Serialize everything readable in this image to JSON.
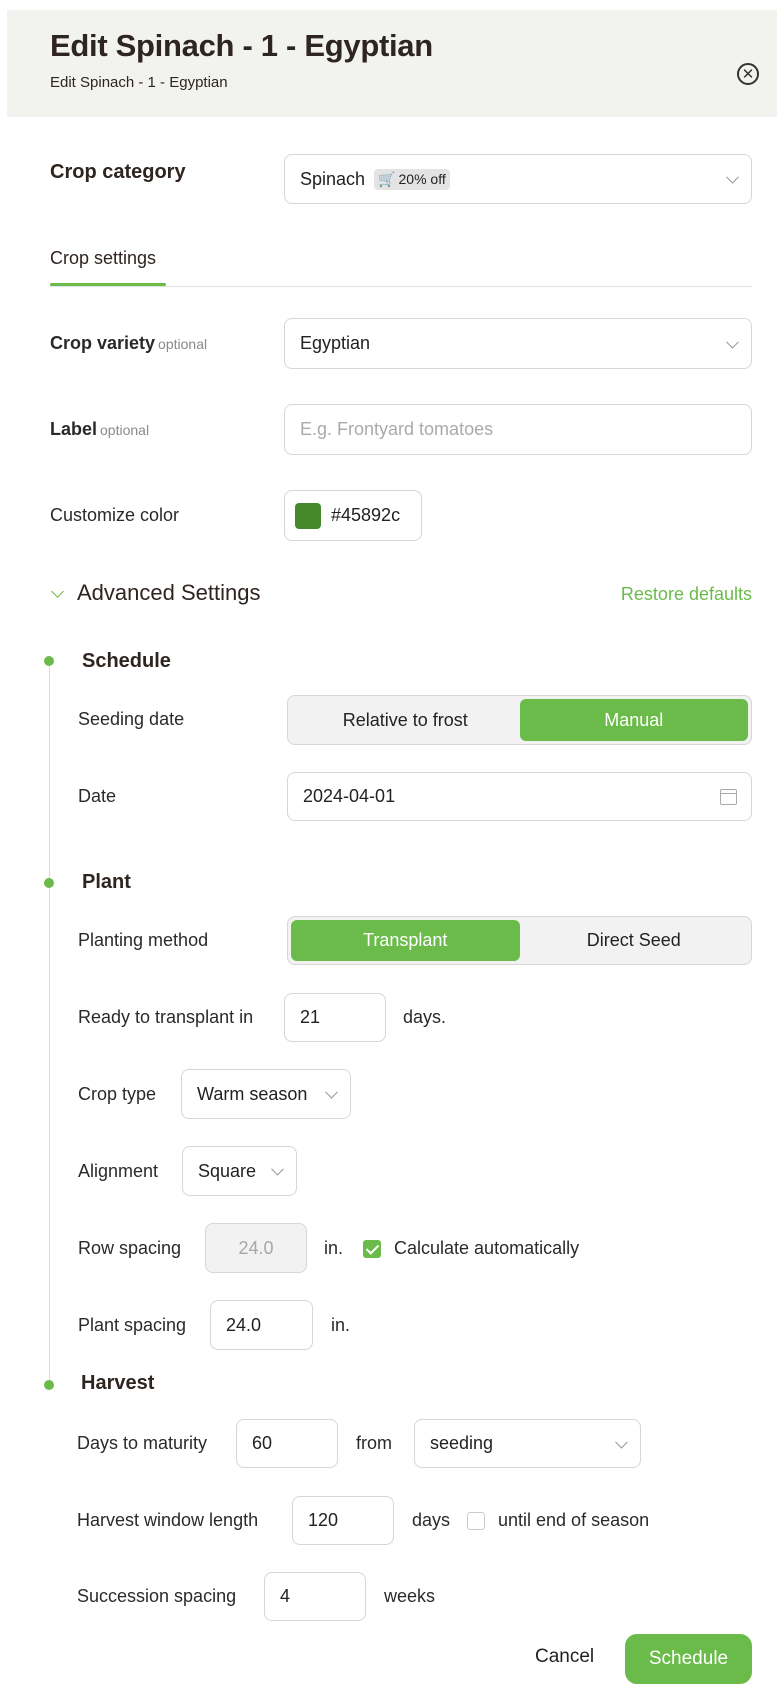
{
  "header": {
    "title": "Edit Spinach - 1 - Egyptian",
    "subtitle": "Edit Spinach - 1 - Egyptian",
    "close_icon": "close-circle-icon"
  },
  "crop_category": {
    "label": "Crop category",
    "value": "Spinach",
    "badge_icon": "cart-icon",
    "badge_text": "20% off"
  },
  "tabs": {
    "active": "Crop settings"
  },
  "crop_variety": {
    "label": "Crop variety",
    "optional": "optional",
    "value": "Egyptian"
  },
  "label_field": {
    "label": "Label",
    "optional": "optional",
    "placeholder": "E.g. Frontyard tomatoes"
  },
  "color": {
    "label": "Customize color",
    "value": "#45892c"
  },
  "advanced": {
    "title": "Advanced Settings",
    "restore": "Restore defaults"
  },
  "schedule": {
    "title": "Schedule",
    "seeding_label": "Seeding date",
    "seeding_options": [
      "Relative to frost",
      "Manual"
    ],
    "seeding_selected": "Manual",
    "date_label": "Date",
    "date_value": "2024-04-01"
  },
  "plant": {
    "title": "Plant",
    "method_label": "Planting method",
    "method_options": [
      "Transplant",
      "Direct Seed"
    ],
    "method_selected": "Transplant",
    "transplant_label": "Ready to transplant in",
    "transplant_value": "21",
    "transplant_unit": "days.",
    "crop_type_label": "Crop type",
    "crop_type_value": "Warm season",
    "alignment_label": "Alignment",
    "alignment_value": "Square",
    "row_spacing_label": "Row spacing",
    "row_spacing_value": "24.0",
    "row_spacing_unit": "in.",
    "calc_auto_label": "Calculate automatically",
    "calc_auto_checked": true,
    "plant_spacing_label": "Plant spacing",
    "plant_spacing_value": "24.0",
    "plant_spacing_unit": "in."
  },
  "harvest": {
    "title": "Harvest",
    "maturity_label": "Days to maturity",
    "maturity_value": "60",
    "from_label": "from",
    "from_value": "seeding",
    "window_label": "Harvest window length",
    "window_value": "120",
    "window_unit": "days",
    "end_season_label": "until end of season",
    "end_season_checked": false,
    "succession_label": "Succession spacing",
    "succession_value": "4",
    "succession_unit": "weeks"
  },
  "footer": {
    "cancel": "Cancel",
    "schedule": "Schedule"
  },
  "colors": {
    "accent": "#6bbb4a",
    "swatch": "#45892c",
    "header_bg": "#f2f3ee"
  }
}
